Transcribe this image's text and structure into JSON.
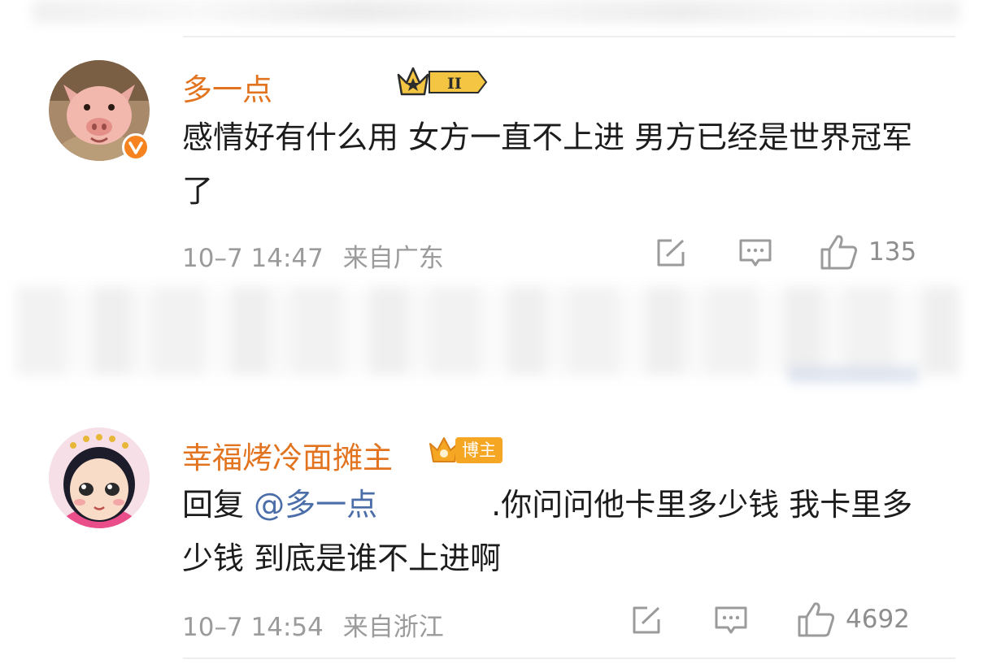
{
  "comments": [
    {
      "username": "多一点",
      "text": "感情好有什么用 女方一直不上进 男方已经是世界冠军了",
      "time": "10–7 14:47",
      "location": "来自广东",
      "likes": "135",
      "level_badge": "II",
      "avatar_icon": "pig-avatar",
      "verified_icon": "verified-v-icon"
    },
    {
      "username": "幸福烤冷面摊主",
      "badge": "博主",
      "reply_prefix": "回复",
      "mention": "@多一点",
      "text": ".你问问他卡里多少钱 我卡里多少钱 到底是谁不上进啊",
      "time": "10–7 14:54",
      "location": "来自浙江",
      "likes": "4692",
      "avatar_icon": "cartoon-girl-avatar"
    }
  ],
  "colors": {
    "username": "#e2731f",
    "mention": "#4b6ea8",
    "meta": "#9b9b9b",
    "badge": "#f5a623"
  }
}
